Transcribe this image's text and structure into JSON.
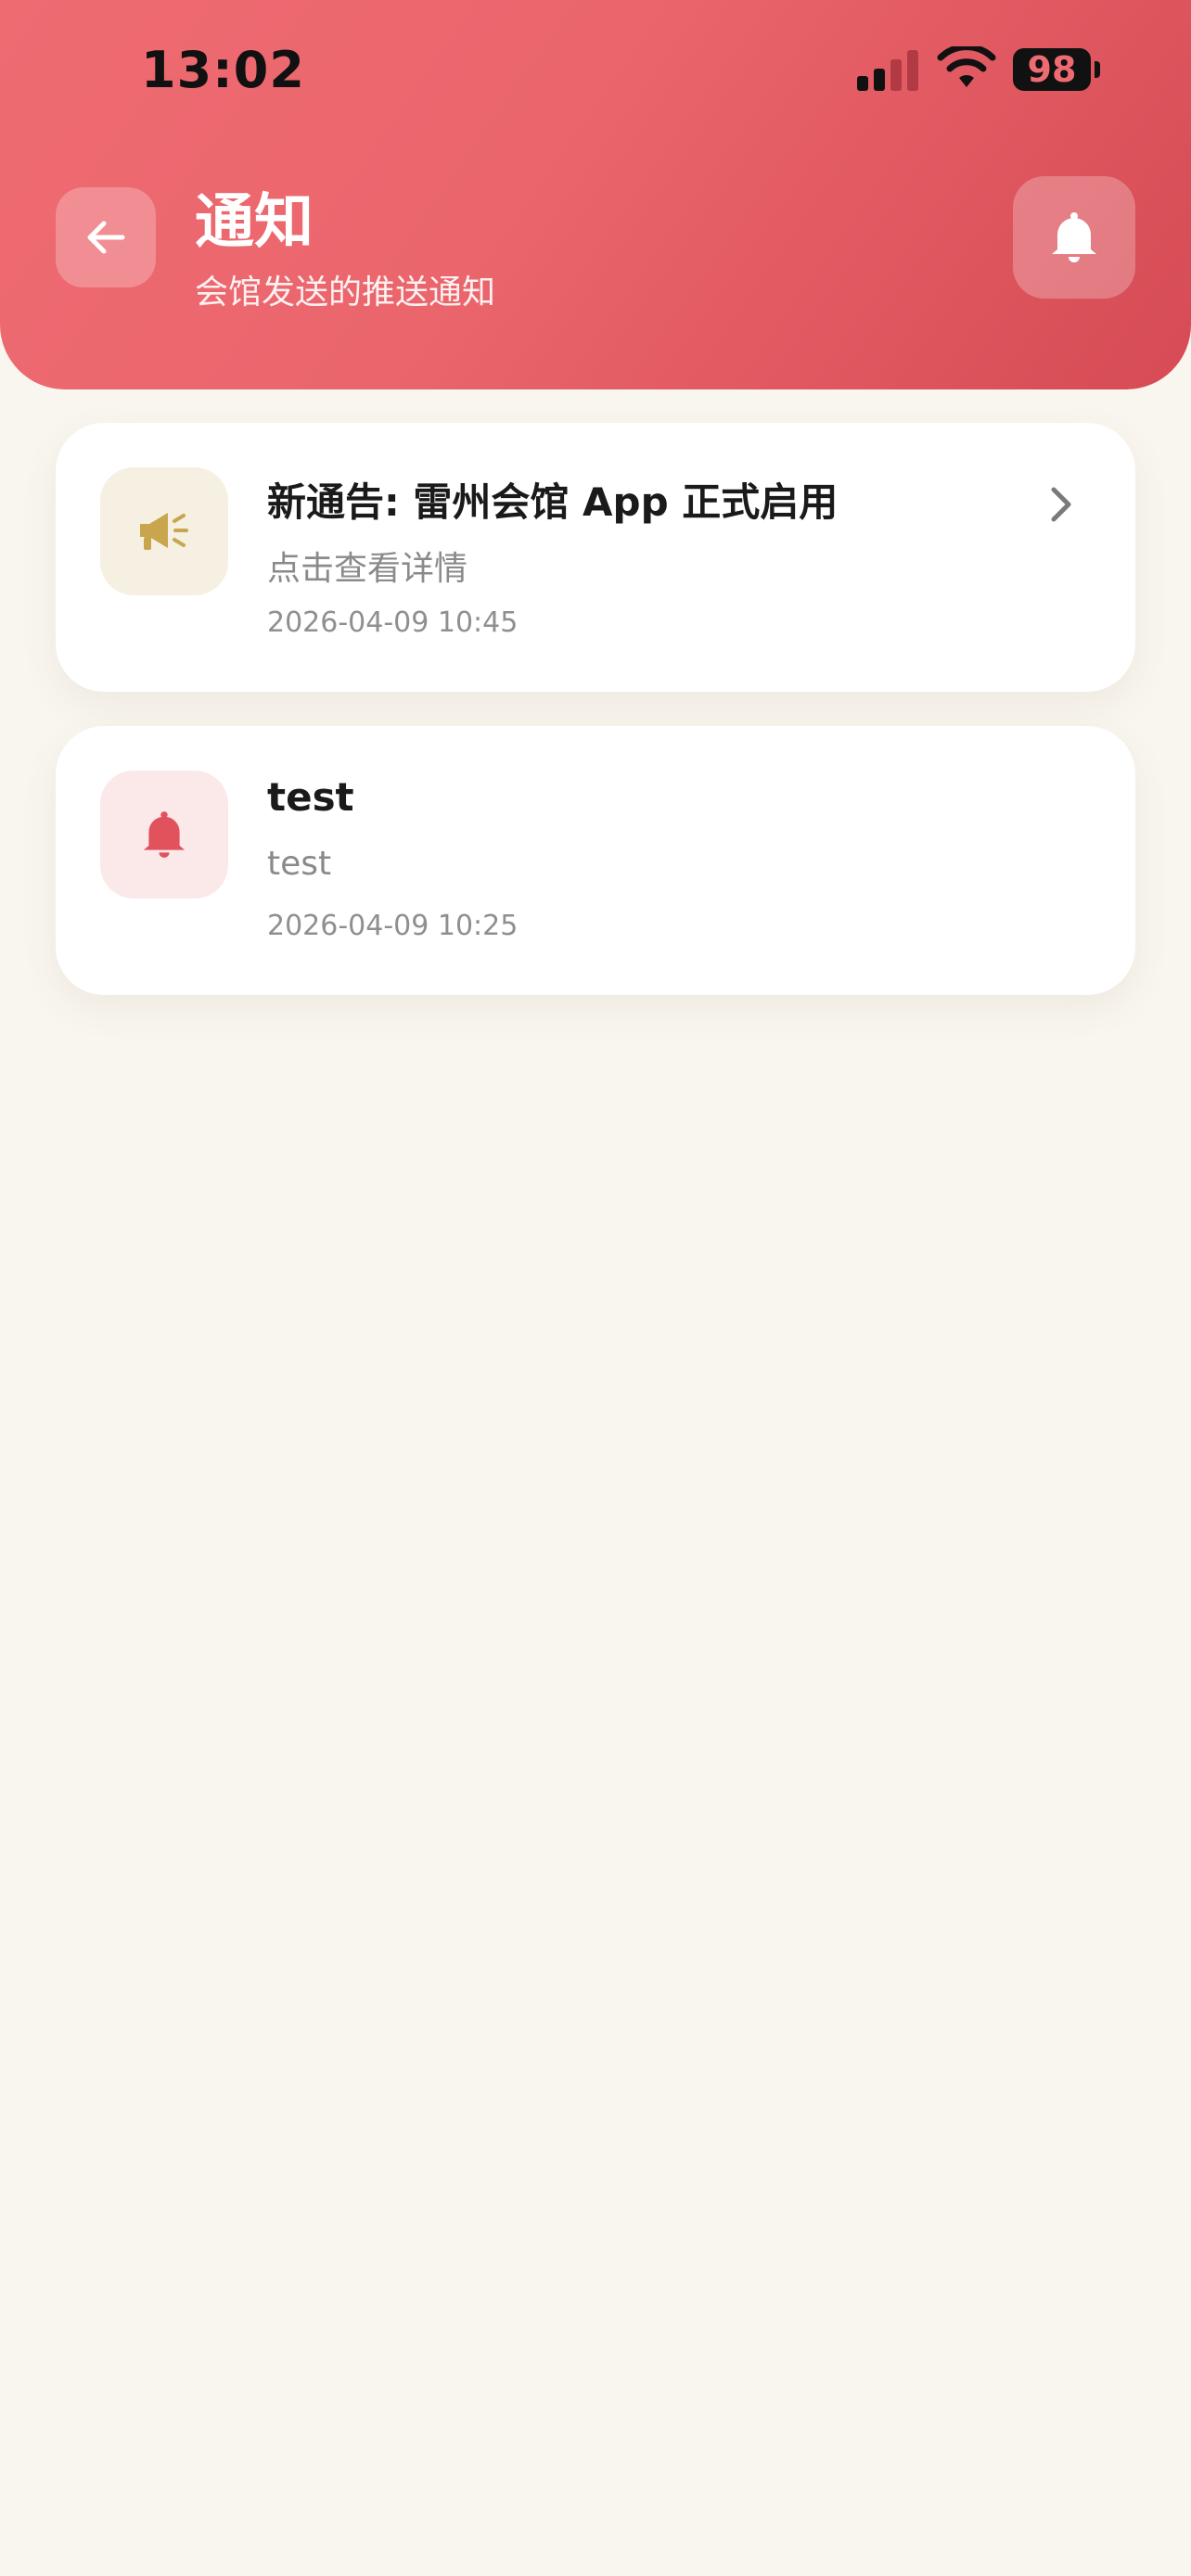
{
  "status_bar": {
    "time": "13:02",
    "battery": "98",
    "icons": [
      "signal-icon",
      "wifi-icon",
      "battery-icon"
    ]
  },
  "header": {
    "title": "通知",
    "subtitle": "会馆发送的推送通知",
    "back_icon": "arrow-left-icon",
    "action_icon": "bell-icon"
  },
  "notifications": [
    {
      "icon": "megaphone-icon",
      "title": "新通告: 雷州会馆 App 正式启用",
      "body": "点击查看详情",
      "time": "2026-04-09 10:45",
      "has_chevron": true
    },
    {
      "icon": "bell-icon",
      "title": "test",
      "body": "test",
      "time": "2026-04-09 10:25",
      "has_chevron": false
    }
  ],
  "colors": {
    "header_start": "#ef6b72",
    "header_end": "#d64b55",
    "background": "#f9f6ef",
    "announcement_icon": "#c9a64e",
    "announcement_icon_bg": "#f6f0e2",
    "bell_icon": "#e2525c",
    "bell_icon_bg": "#fbe9ea"
  }
}
